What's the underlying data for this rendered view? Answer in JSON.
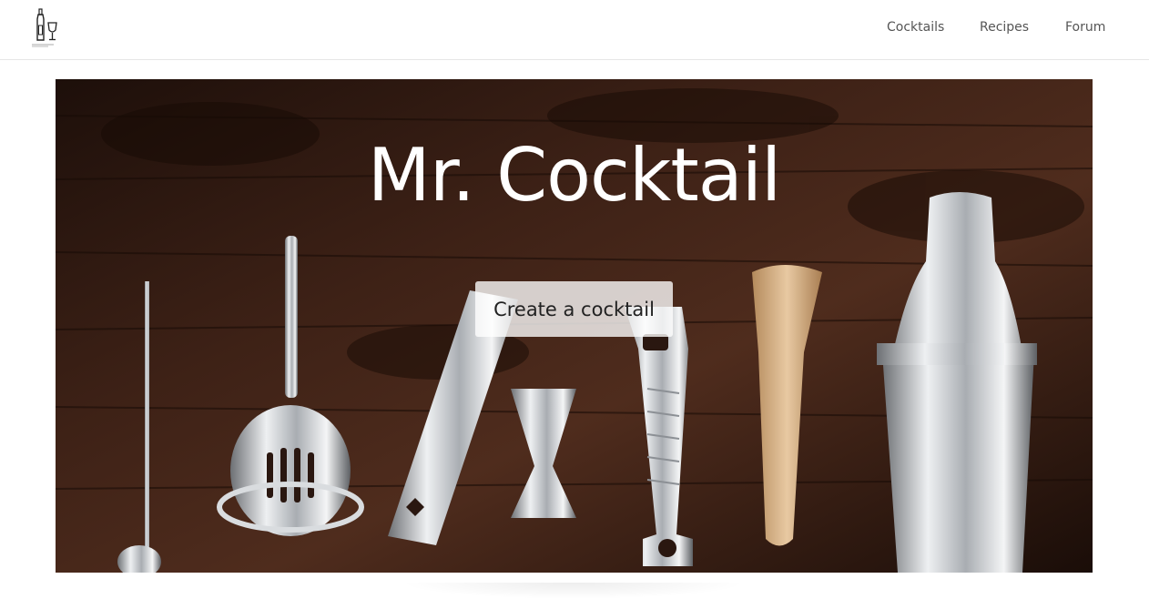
{
  "nav": {
    "logo": "bottle-and-glass-icon",
    "links": [
      "Cocktails",
      "Recipes",
      "Forum"
    ]
  },
  "hero": {
    "title": "Mr. Cocktail",
    "cta_label": "Create a cocktail",
    "image": "bar-tools-on-wood-photo"
  },
  "colors": {
    "wood_dark": "#2a1710",
    "wood_mid": "#4a2a1c",
    "steel": "#c9ccd0",
    "muddler": "#d8b58c",
    "nav_text": "#555555"
  }
}
